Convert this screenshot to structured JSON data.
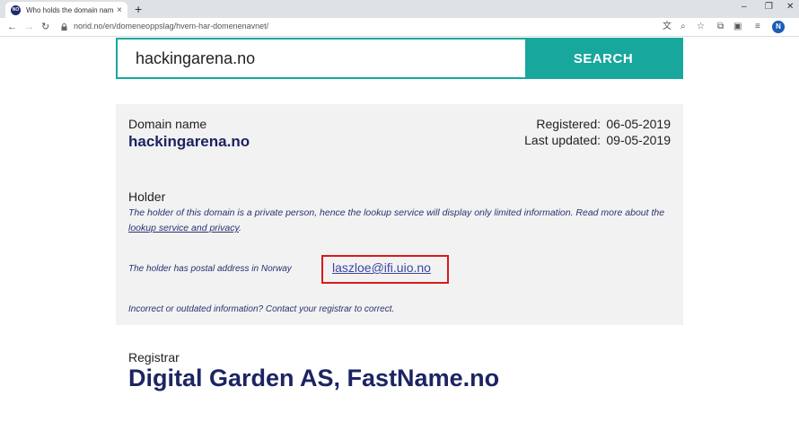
{
  "browser": {
    "tab_title": "Who holds the domain name? - N",
    "favicon_text": "NO",
    "new_tab": "+",
    "tab_close": "×",
    "url": "norid.no/en/domeneoppslag/hvem-har-domenenavnet/",
    "profile_initial": "N",
    "window_controls": {
      "minimize": "–",
      "maximize": "❐",
      "close": "✕"
    }
  },
  "search": {
    "query": "hackingarena.no",
    "button_label": "SEARCH"
  },
  "domain": {
    "label": "Domain name",
    "value": "hackingarena.no",
    "registered_label": "Registered:",
    "registered_value": "06-05-2019",
    "updated_label": "Last updated:",
    "updated_value": "09-05-2019"
  },
  "holder": {
    "label": "Holder",
    "note_prefix": "The holder of this domain is a private person, hence the lookup service will display only limited information. Read more about the ",
    "note_link": "lookup service and privacy",
    "note_suffix": ".",
    "postal": "The holder has postal address in Norway",
    "email": "laszloe@ifi.uio.no",
    "incorrect": "Incorrect or outdated information? Contact your registrar to correct."
  },
  "registrar": {
    "label": "Registrar",
    "value": "Digital Garden AS, FastName.no"
  },
  "colors": {
    "accent": "#17a79d",
    "title_navy": "#1c2463",
    "highlight_red": "#d91a1a"
  }
}
